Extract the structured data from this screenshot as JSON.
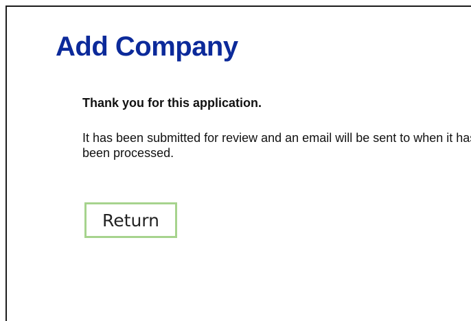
{
  "page": {
    "title": "Add Company"
  },
  "confirmation": {
    "heading": "Thank you for this application.",
    "message": "It has been submitted for review and an email will be sent to when it has been processed."
  },
  "actions": {
    "return_label": "Return"
  },
  "colors": {
    "title": "#0c2a9a",
    "button_border": "#a6d38d",
    "frame_border": "#1a1a1a"
  }
}
